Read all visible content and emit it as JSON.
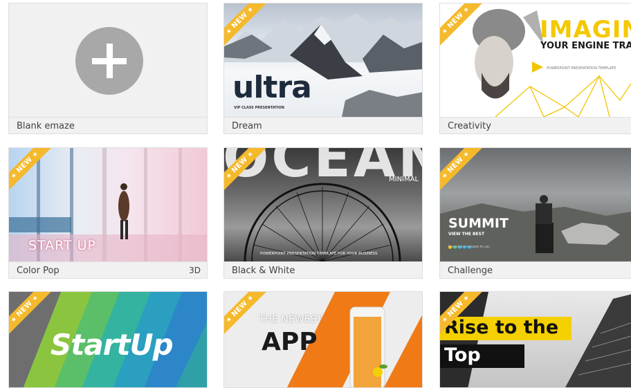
{
  "cards": [
    {
      "title": "Blank emaze",
      "new": ""
    },
    {
      "title": "Dream",
      "new": "NEW",
      "thumb_text": {
        "logo": "ultra",
        "sub": "VIP CLASS PRESENTATION"
      }
    },
    {
      "title": "Creativity",
      "new": "NEW",
      "thumb_text": {
        "headline": "IMAGINE",
        "sub": "YOUR ENGINE TRADE",
        "small": "POWERPOINT PRESENTATION TEMPLATE"
      }
    },
    {
      "title": "Color Pop",
      "tag": "3D",
      "new": "NEW",
      "thumb_text": {
        "headline": "START UP"
      }
    },
    {
      "title": "Black & White",
      "new": "NEW",
      "thumb_text": {
        "headline": "OCEAN",
        "sub": "MINIMAL",
        "small": "POWERPOINT PRESENTATION TEMPLATE FOR YOUR BUSINESS"
      }
    },
    {
      "title": "Challenge",
      "new": "NEW",
      "thumb_text": {
        "headline": "SUMMIT",
        "sub": "VIEW THE BEST",
        "small": "Presentation template for you"
      }
    },
    {
      "title": "",
      "new": "NEW",
      "thumb_text": {
        "headline": "StartUp"
      }
    },
    {
      "title": "",
      "new": "NEW",
      "thumb_text": {
        "headline": "APP",
        "sub": "THE NEWEST"
      }
    },
    {
      "title": "",
      "new": "NEW",
      "thumb_text": {
        "line1": "Rise to the",
        "line2": "Top"
      }
    }
  ],
  "colors": {
    "ribbon": "#f5b92c",
    "accent_yellow": "#f5d000",
    "orange": "#f07a16"
  }
}
